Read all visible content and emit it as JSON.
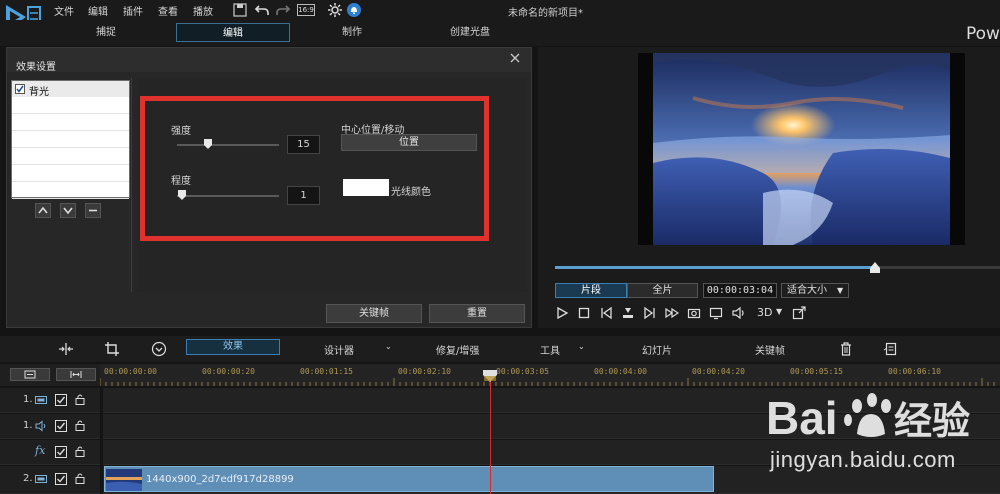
{
  "menubar": {
    "items": [
      "文件",
      "编辑",
      "插件",
      "查看",
      "播放"
    ],
    "aspect": "16:9",
    "project_title": "未命名的新项目*"
  },
  "main_tabs": {
    "items": [
      "捕捉",
      "编辑",
      "制作",
      "创建光盘"
    ],
    "active_index": 1,
    "brand": "Pow"
  },
  "effect_panel": {
    "title": "效果设置",
    "list_items": [
      {
        "label": "背光",
        "checked": true
      }
    ],
    "params": {
      "strength_label": "强度",
      "strength_value": "15",
      "strength_level": 0.3,
      "degree_label": "程度",
      "degree_value": "1",
      "degree_level": 0.05,
      "center_label": "中心位置/移动",
      "position_button": "位置",
      "light_color_label": "光线颜色",
      "light_color": "#ffffff"
    },
    "keyframe_button": "关键帧",
    "reset_button": "重置",
    "highlight_color": "#e0322d"
  },
  "preview": {
    "clip_mode": "片段",
    "full_mode": "全片",
    "timecode": "00:00:03:04",
    "fit": "适合大小",
    "three_d": "3D",
    "progress": 0.72
  },
  "toolbar": {
    "effects": "效果",
    "designer": "设计器",
    "fix_enhance": "修复/增强",
    "tools": "工具",
    "slideshow": "幻灯片",
    "keyframe": "关键帧"
  },
  "timeline": {
    "ruler_labels": [
      "00:00:00:00",
      "00:00:00:20",
      "00:00:01:15",
      "00:00:02:10",
      "00:00:03:05",
      "00:00:04:00",
      "00:00:04:20",
      "00:00:05:15",
      "00:00:06:10"
    ],
    "tracks": [
      {
        "num": "1.",
        "type": "video"
      },
      {
        "num": "1.",
        "type": "audio"
      },
      {
        "num": "",
        "type": "fx",
        "label": "fx"
      },
      {
        "num": "2.",
        "type": "video"
      }
    ],
    "clip_label": "1440x900_2d7edf917d28899",
    "playhead_time": "00:00:03:04"
  },
  "watermark": {
    "brand": "Bai",
    "brand_cn": "经验",
    "url": "jingyan.baidu.com"
  }
}
